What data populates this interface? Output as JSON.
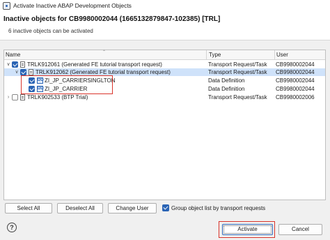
{
  "window": {
    "title": "Activate Inactive ABAP Development Objects"
  },
  "header": {
    "title": "Inactive objects for CB9980002044 (1665132879847-102385) [TRL]",
    "subtitle": "6 inactive objects can be activated"
  },
  "table": {
    "columns": {
      "name": "Name",
      "type": "Type",
      "user": "User"
    },
    "rows": [
      {
        "name": "TRLK912061 (Generated FE tutorial transport request)",
        "type": "Transport Request/Task",
        "user": "CB9980002044"
      },
      {
        "name": "TRLK912062 (Generated FE tutorial transport request)",
        "type": "Transport Request/Task",
        "user": "CB9980002044"
      },
      {
        "name": "ZI_JP_CARRIERSINGLTON",
        "type": "Data Definition",
        "user": "CB9980002044"
      },
      {
        "name": "ZI_JP_CARRIER",
        "type": "Data Definition",
        "user": "CB9980002044"
      },
      {
        "name": "TRLK902533 (BTP Trial)",
        "type": "Transport Request/Task",
        "user": "CB9980002006"
      }
    ]
  },
  "buttons": {
    "select_all": "Select All",
    "deselect_all": "Deselect All",
    "change_user": "Change User",
    "activate": "Activate",
    "cancel": "Cancel"
  },
  "group_option": {
    "label": "Group object list by transport requests",
    "checked": true
  },
  "colors": {
    "accent": "#2a64b5",
    "highlight": "#d9342b",
    "selection": "#cfe2fa"
  }
}
